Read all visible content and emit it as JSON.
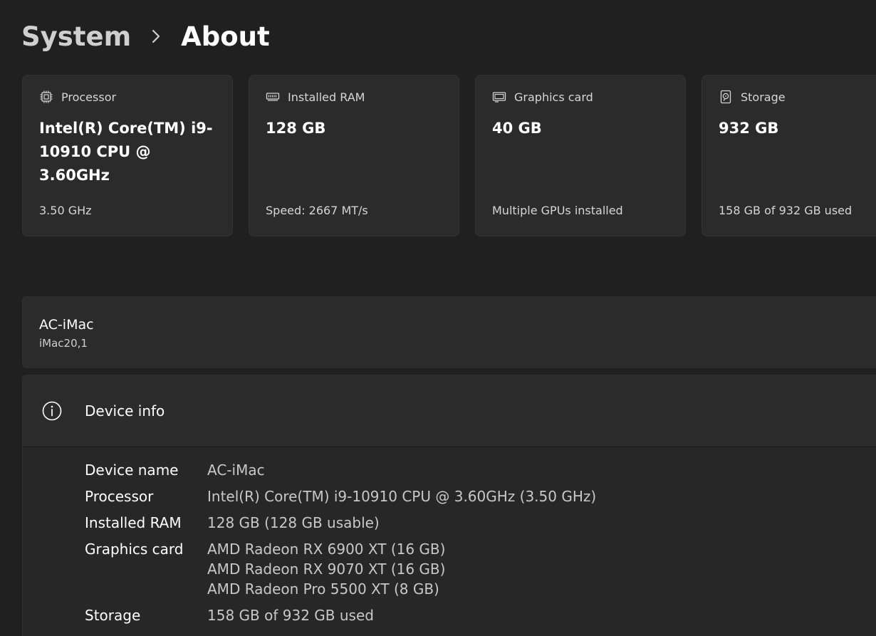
{
  "breadcrumb": {
    "parent": "System",
    "current": "About"
  },
  "cards": [
    {
      "label": "Processor",
      "icon": "processor-chip-icon",
      "value": "Intel(R) Core(TM) i9-10910 CPU @ 3.60GHz",
      "sub": "3.50 GHz"
    },
    {
      "label": "Installed RAM",
      "icon": "ram-icon",
      "value": "128 GB",
      "sub": "Speed: 2667 MT/s"
    },
    {
      "label": "Graphics card",
      "icon": "graphics-card-icon",
      "value": "40 GB",
      "sub": "Multiple GPUs installed"
    },
    {
      "label": "Storage",
      "icon": "storage-drive-icon",
      "value": "932 GB",
      "sub": "158 GB of 932 GB used"
    }
  ],
  "device": {
    "name": "AC-iMac",
    "model": "iMac20,1"
  },
  "device_info": {
    "title": "Device info",
    "icon": "info-icon",
    "rows": [
      {
        "key": "Device name",
        "values": [
          "AC-iMac"
        ]
      },
      {
        "key": "Processor",
        "values": [
          "Intel(R) Core(TM) i9-10910 CPU @ 3.60GHz (3.50 GHz)"
        ]
      },
      {
        "key": "Installed RAM",
        "values": [
          "128 GB (128 GB usable)"
        ]
      },
      {
        "key": "Graphics card",
        "values": [
          "AMD Radeon RX 6900 XT (16 GB)",
          "AMD Radeon RX 9070 XT (16 GB)",
          "AMD Radeon Pro 5500 XT (8 GB)"
        ]
      },
      {
        "key": "Storage",
        "values": [
          "158 GB of 932 GB used"
        ]
      }
    ]
  },
  "colors": {
    "background": "#202020",
    "card": "#2b2b2b",
    "text_primary": "#ffffff",
    "text_secondary": "#c8c8c8"
  }
}
